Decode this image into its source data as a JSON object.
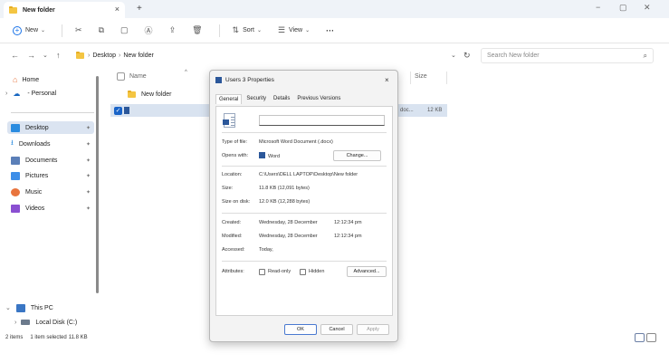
{
  "window": {
    "tab_title": "New folder",
    "new_tab": "+",
    "tab_close": "×",
    "minimize": "−",
    "restore": "▢",
    "close": "✕"
  },
  "toolbar": {
    "new_label": "New",
    "sort_label": "Sort",
    "view_label": "View",
    "more_label": "···"
  },
  "address": {
    "crumbs": [
      "Desktop",
      "New folder"
    ],
    "search_placeholder": "Search New folder"
  },
  "sidebar": {
    "home": "Home",
    "personal": "- Personal",
    "items": [
      {
        "label": "Desktop",
        "icon": "desktop-icon",
        "color": "#2b8ce0"
      },
      {
        "label": "Downloads",
        "icon": "download-icon",
        "color": "#2b8ce0"
      },
      {
        "label": "Documents",
        "icon": "documents-icon",
        "color": "#5b7fb8"
      },
      {
        "label": "Pictures",
        "icon": "pictures-icon",
        "color": "#3d8ee8"
      },
      {
        "label": "Music",
        "icon": "music-icon",
        "color": "#e8743d"
      },
      {
        "label": "Videos",
        "icon": "videos-icon",
        "color": "#8a4fd1"
      }
    ],
    "this_pc": "This PC",
    "local_disk": "Local Disk (C:)"
  },
  "list": {
    "col_name": "Name",
    "col_size": "Size",
    "rows": [
      {
        "name": "New folder",
        "type_partial": "",
        "size": ""
      },
      {
        "name": "",
        "type_partial": "doc...",
        "size": "12 KB"
      }
    ]
  },
  "status": {
    "items": "2 items",
    "selected": "1 item selected",
    "size": "11.8 KB"
  },
  "dialog": {
    "title": "Users 3 Properties",
    "close": "×",
    "tabs": [
      "General",
      "Security",
      "Details",
      "Previous Versions"
    ],
    "name_value": "",
    "type_label": "Type of file:",
    "type_value": "Microsoft Word Document (.docx)",
    "opens_label": "Opens with:",
    "opens_value": "Word",
    "change_btn": "Change...",
    "location_label": "Location:",
    "location_value": "C:\\Users\\DELL LAPTOP\\Desktop\\New folder",
    "size_label": "Size:",
    "size_value": "11.8 KB (12,091 bytes)",
    "sizedisk_label": "Size on disk:",
    "sizedisk_value": "12.0 KB (12,288 bytes)",
    "created_label": "Created:",
    "created_value": "Wednesday, 28 December",
    "created_time": "12:12:34 pm",
    "modified_label": "Modified:",
    "modified_value": "Wednesday, 28 December",
    "modified_time": "12:12:34 pm",
    "accessed_label": "Accessed:",
    "accessed_value": "Today,",
    "attributes_label": "Attributes:",
    "readonly_label": "Read-only",
    "hidden_label": "Hidden",
    "advanced_btn": "Advanced...",
    "ok_btn": "OK",
    "cancel_btn": "Cancel",
    "apply_btn": "Apply"
  }
}
